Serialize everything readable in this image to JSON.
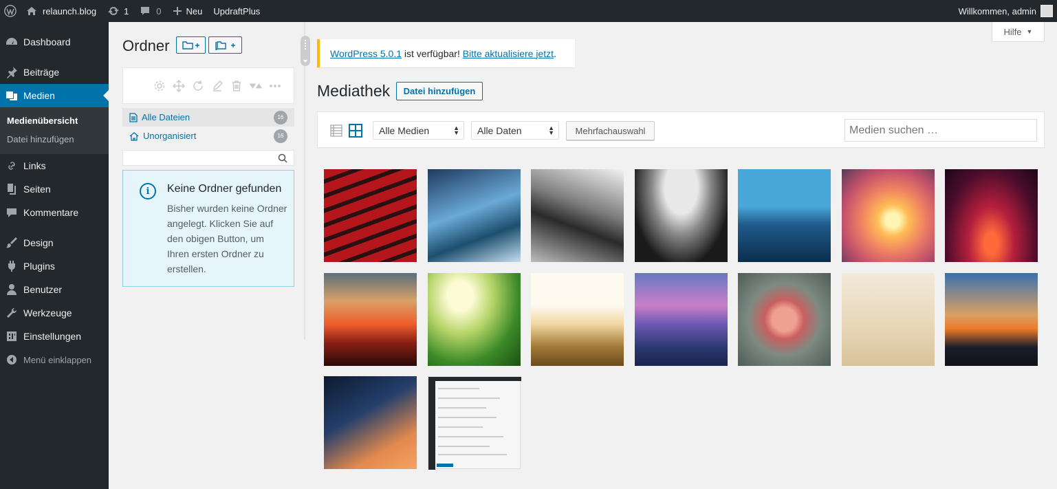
{
  "adminbar": {
    "site_name": "relaunch.blog",
    "updates_count": "1",
    "comments_count": "0",
    "new_label": "Neu",
    "plugin_label": "UpdraftPlus",
    "greeting": "Willkommen, admin"
  },
  "sidebar": {
    "items": [
      {
        "label": "Dashboard",
        "icon": "dashboard-icon"
      },
      {
        "label": "Beiträge",
        "icon": "pin-icon"
      },
      {
        "label": "Medien",
        "icon": "media-icon",
        "active": true
      },
      {
        "label": "Links",
        "icon": "link-icon"
      },
      {
        "label": "Seiten",
        "icon": "pages-icon"
      },
      {
        "label": "Kommentare",
        "icon": "comment-icon"
      },
      {
        "label": "Design",
        "icon": "brush-icon"
      },
      {
        "label": "Plugins",
        "icon": "plugin-icon"
      },
      {
        "label": "Benutzer",
        "icon": "user-icon"
      },
      {
        "label": "Werkzeuge",
        "icon": "wrench-icon"
      },
      {
        "label": "Einstellungen",
        "icon": "settings-icon"
      }
    ],
    "submenu": [
      "Medienübersicht",
      "Datei hinzufügen"
    ],
    "collapse_label": "Menü einklappen"
  },
  "folders": {
    "title": "Ordner",
    "rows": [
      {
        "label": "Alle Dateien",
        "count": "16"
      },
      {
        "label": "Unorganisiert",
        "count": "16"
      }
    ],
    "notice_title": "Keine Ordner gefunden",
    "notice_body": "Bisher wurden keine Ordner angelegt. Klicken Sie auf den obigen Button, um Ihren ersten Ordner zu erstellen."
  },
  "main": {
    "help_label": "Hilfe",
    "nag_link_version": "WordPress 5.0.1",
    "nag_text": " ist verfügbar! ",
    "nag_link_update": "Bitte aktualisiere jetzt",
    "nag_end": ".",
    "title": "Mediathek",
    "add_button": "Datei hinzufügen",
    "filter_type": "Alle Medien",
    "filter_date": "Alle Daten",
    "bulk_select": "Mehrfachauswahl",
    "search_placeholder": "Medien suchen …"
  },
  "colors": {
    "admin_dark": "#23282d",
    "accent": "#0073aa",
    "nag_border": "#ffb900"
  },
  "media_items_count": 16
}
